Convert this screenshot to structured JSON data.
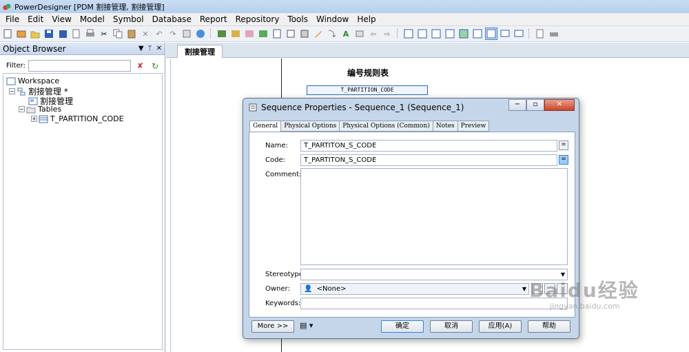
{
  "window": {
    "title": "PowerDesigner [PDM 割接管理, 割接管理]"
  },
  "menu": [
    "File",
    "Edit",
    "View",
    "Model",
    "Symbol",
    "Database",
    "Report",
    "Repository",
    "Tools",
    "Window",
    "Help"
  ],
  "object_browser": {
    "title": "Object Browser",
    "filter_label": "Filter:",
    "filter_value": "",
    "tree": {
      "workspace": "Workspace",
      "model": "割接管理 *",
      "diagram": "割接管理",
      "tables_folder": "Tables",
      "table": "T_PARTITION_CODE"
    }
  },
  "document_tab": {
    "label": "割接管理"
  },
  "diagram": {
    "title": "编号规则表",
    "entity": "T_PARTITION_CODE"
  },
  "dialog": {
    "title": "Sequence Properties - Sequence_1 (Sequence_1)",
    "tabs": [
      "General",
      "Physical Options",
      "Physical Options (Common)",
      "Notes",
      "Preview"
    ],
    "active_tab": "General",
    "name_label": "Name:",
    "name_value": "T_PARTITON_S_CODE",
    "code_label": "Code:",
    "code_value": "T_PARTITON_S_CODE",
    "comment_label": "Comment:",
    "comment_value": "",
    "stereotype_label": "Stereotype:",
    "stereotype_value": "",
    "owner_label": "Owner:",
    "owner_value": "<None>",
    "keywords_label": "Keywords:",
    "keywords_value": "",
    "more_button": "More >>",
    "ok_button": "确定",
    "cancel_button": "取消",
    "apply_button": "应用(A)",
    "help_button": "帮助"
  },
  "watermark": {
    "brand": "Baidu经验",
    "url": "jingyan.baidu.com"
  },
  "colors": {
    "titlebar": "#c9dcf2",
    "accent": "#3b7fd9",
    "dialog_frame": "#c5d6ea"
  }
}
